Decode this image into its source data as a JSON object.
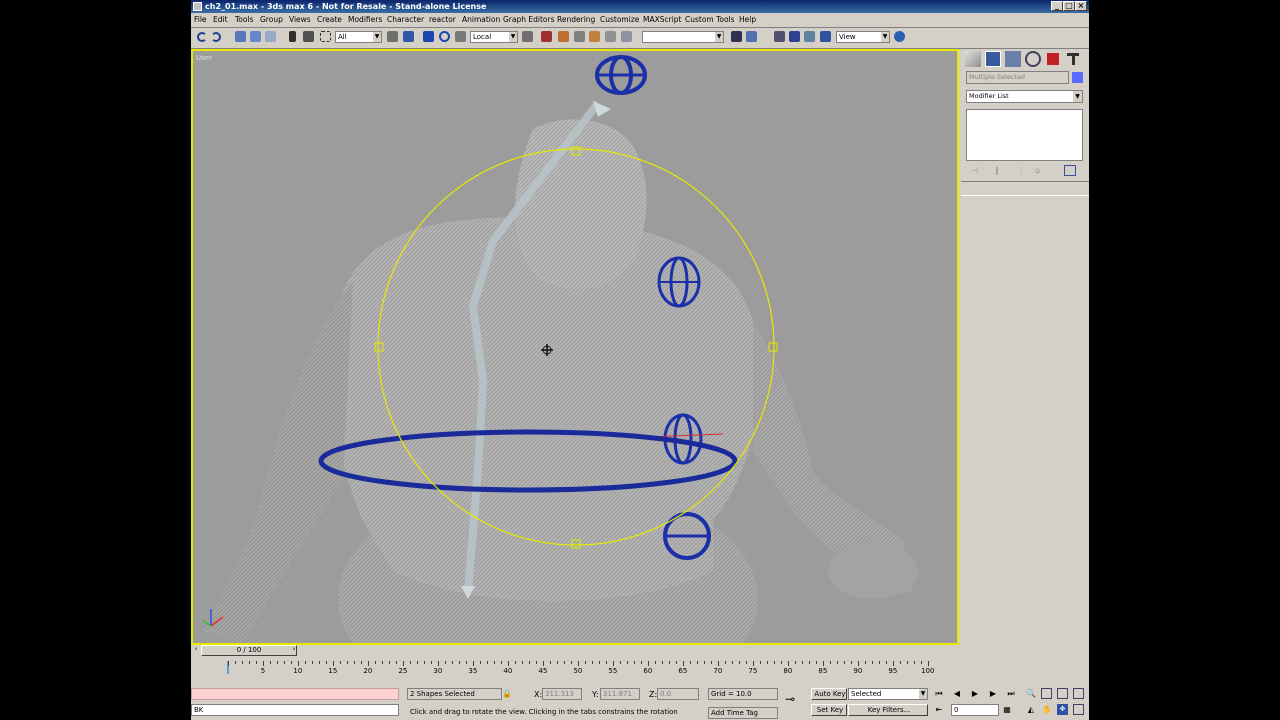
{
  "window": {
    "title": "ch2_01.max - 3ds max 6 - Not for Resale - Stand-alone License"
  },
  "menu": [
    "File",
    "Edit",
    "Tools",
    "Group",
    "Views",
    "Create",
    "Modifiers",
    "Character",
    "reactor",
    "Animation",
    "Graph Editors",
    "Rendering",
    "Customize",
    "MAXScript",
    "Custom Tools",
    "Help"
  ],
  "toolbar": {
    "selection_filter": "All",
    "ref_coord": "Local",
    "named_selection": "",
    "render_type": "View"
  },
  "viewport": {
    "label": "User"
  },
  "command_panel": {
    "name_field": "Multiple Selected",
    "modifier_list": "Modifier List"
  },
  "time_slider": {
    "position": "0 / 100"
  },
  "ruler": {
    "labels": [
      "5",
      "10",
      "15",
      "20",
      "25",
      "30",
      "35",
      "40",
      "45",
      "50",
      "55",
      "60",
      "65",
      "70",
      "75",
      "80",
      "85",
      "90",
      "95",
      "100"
    ]
  },
  "status": {
    "selection": "2 Shapes Selected",
    "x_label": "X:",
    "x_value": "311.313",
    "y_label": "Y:",
    "y_value": "311.871",
    "z_label": "Z:",
    "z_value": "0.0",
    "grid": "Grid = 10.0",
    "prompt": "Click and drag to rotate the view.  Clicking in the tabs constrains the rotation",
    "add_time_tag": "Add Time Tag",
    "auto_key": "Auto Key",
    "set_key": "Set Key",
    "key_mode": "Selected",
    "key_filters": "Key Filters...",
    "frame": "0",
    "listener": "BK"
  }
}
